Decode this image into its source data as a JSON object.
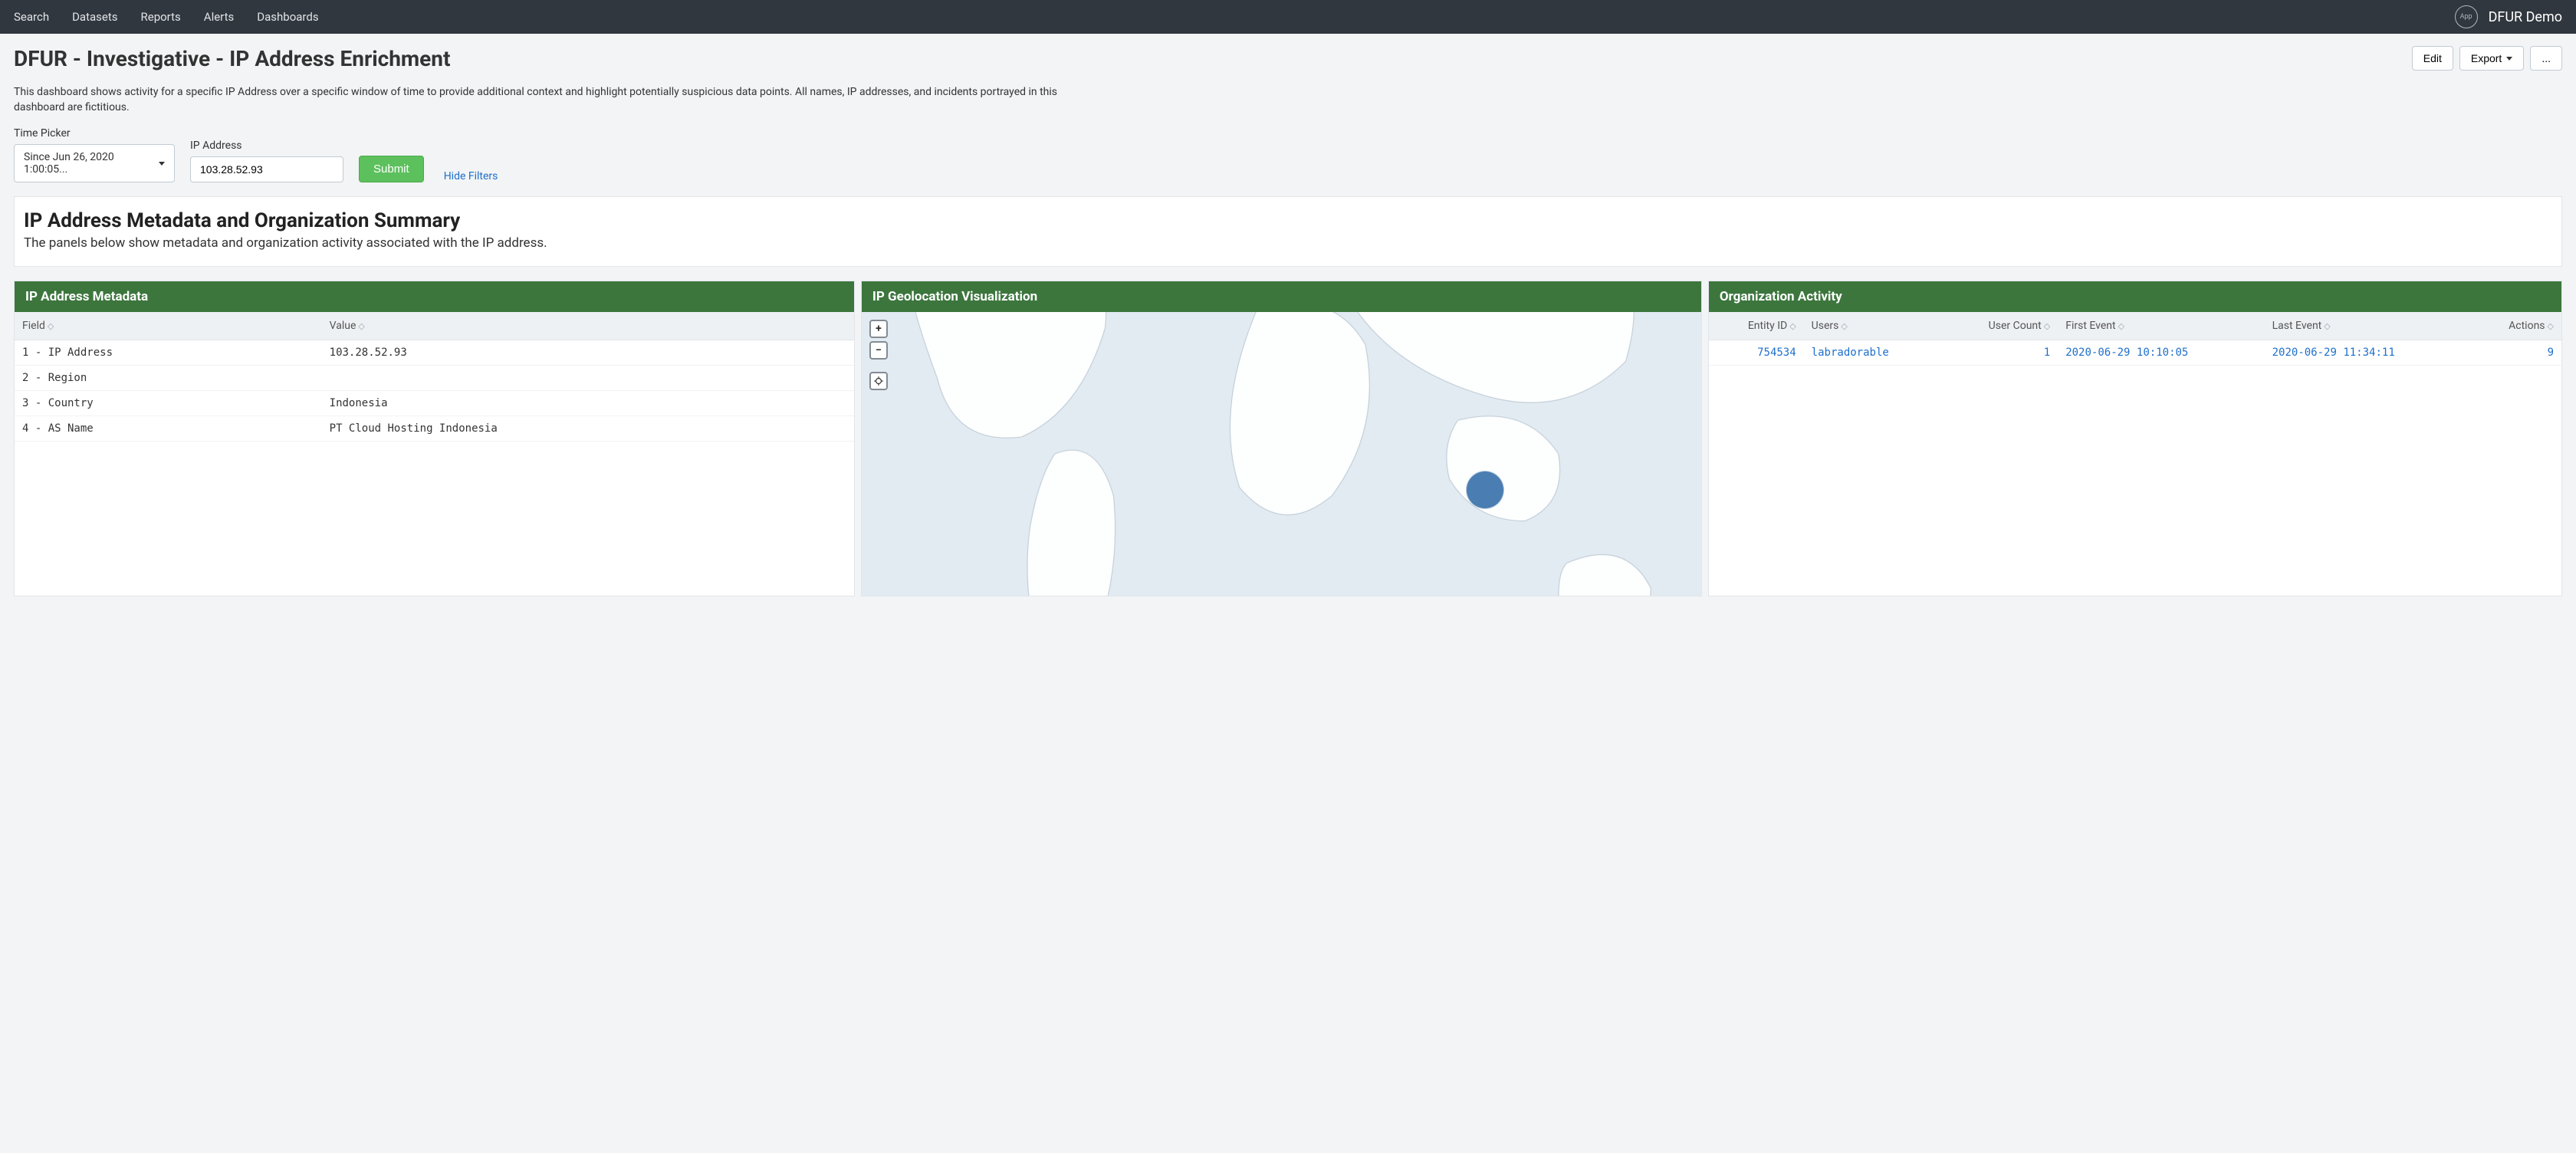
{
  "nav": {
    "items": [
      "Search",
      "Datasets",
      "Reports",
      "Alerts",
      "Dashboards"
    ],
    "app_badge": "App",
    "app_name": "DFUR Demo"
  },
  "header": {
    "title": "DFUR - Investigative - IP Address Enrichment",
    "description": "This dashboard shows activity for a specific IP Address over a specific window of time to provide additional context and highlight potentially suspicious data points. All names, IP addresses, and incidents portrayed in this dashboard are fictitious.",
    "actions": {
      "edit": "Edit",
      "export": "Export",
      "more": "..."
    }
  },
  "filters": {
    "time_label": "Time Picker",
    "time_value": "Since Jun 26, 2020 1:00:05...",
    "ip_label": "IP Address",
    "ip_value": "103.28.52.93",
    "submit": "Submit",
    "hide": "Hide Filters"
  },
  "summary": {
    "title": "IP Address Metadata and Organization Summary",
    "sub": "The panels below show metadata and organization activity associated with the IP address."
  },
  "panel1": {
    "title": "IP Address Metadata",
    "col_field": "Field",
    "col_value": "Value",
    "rows": [
      {
        "field": "1 - IP Address",
        "value": "103.28.52.93"
      },
      {
        "field": "2 - Region",
        "value": ""
      },
      {
        "field": "3 - Country",
        "value": "Indonesia"
      },
      {
        "field": "4 - AS Name",
        "value": "PT Cloud Hosting Indonesia"
      }
    ]
  },
  "panel2": {
    "title": "IP Geolocation Visualization"
  },
  "panel3": {
    "title": "Organization Activity",
    "cols": {
      "entity": "Entity ID",
      "users": "Users",
      "user_count": "User Count",
      "first": "First Event",
      "last": "Last Event",
      "actions": "Actions"
    },
    "rows": [
      {
        "entity": "754534",
        "users": "labradorable",
        "user_count": "1",
        "first": "2020-06-29 10:10:05",
        "last": "2020-06-29 11:34:11",
        "actions": "9"
      }
    ]
  }
}
